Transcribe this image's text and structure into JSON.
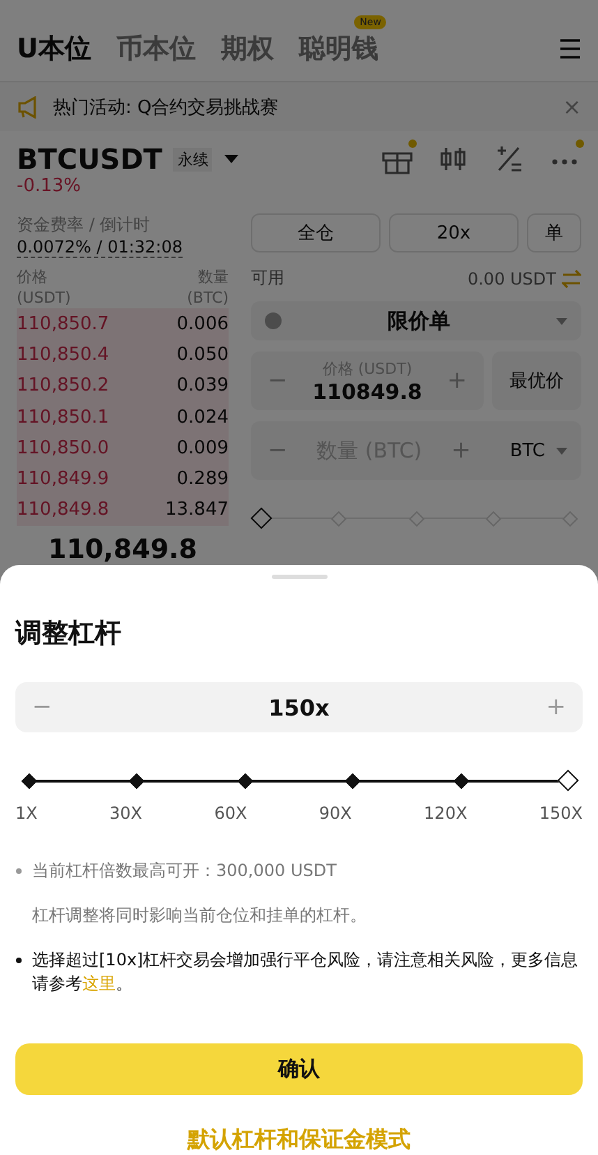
{
  "tabs": [
    {
      "label": "U本位",
      "selected": true
    },
    {
      "label": "币本位",
      "selected": false
    },
    {
      "label": "期权",
      "selected": false
    },
    {
      "label": "聪明钱",
      "selected": false,
      "badge": "New"
    }
  ],
  "announcement": {
    "text": "热门活动: Q合约交易挑战赛",
    "close": "×"
  },
  "symbol": {
    "name": "BTCUSDT",
    "tag": "永续",
    "change": "-0.13%"
  },
  "toolbar": [
    {
      "kind": "gift",
      "dot": true
    },
    {
      "kind": "candles",
      "dot": false
    },
    {
      "kind": "calculator",
      "dot": false
    },
    {
      "kind": "more",
      "dot": true
    }
  ],
  "funding": {
    "label": "资金费率 / 倒计时",
    "value": "0.0072% / 01:32:08"
  },
  "order_book": {
    "columns": [
      {
        "label": "价格",
        "unit": "(USDT)"
      },
      {
        "label": "数量",
        "unit": "(BTC)"
      }
    ],
    "asks": [
      {
        "price": "110,850.7",
        "qty": "0.006"
      },
      {
        "price": "110,850.4",
        "qty": "0.050"
      },
      {
        "price": "110,850.2",
        "qty": "0.039"
      },
      {
        "price": "110,850.1",
        "qty": "0.024"
      },
      {
        "price": "110,850.0",
        "qty": "0.009"
      },
      {
        "price": "110,849.9",
        "qty": "0.289"
      },
      {
        "price": "110,849.8",
        "qty": "13.847"
      }
    ],
    "last_price": "110,849.8"
  },
  "order_form": {
    "margin_mode": "全仓",
    "leverage": "20x",
    "position_mode": "单",
    "available_label": "可用",
    "available": "0.00 USDT",
    "order_type": "限价单",
    "price_label": "价格 (USDT)",
    "price": "110849.8",
    "minus": "−",
    "plus": "+",
    "best_price": "最优价",
    "qty_placeholder": "数量 (BTC)",
    "qty_unit": "BTC",
    "level": 0
  },
  "sheet": {
    "title": "调整杠杆",
    "minus": "−",
    "value": "150x",
    "plus": "+",
    "level": 1,
    "marks": [
      {
        "label": "1X",
        "selected": false
      },
      {
        "label": "30X",
        "selected": false
      },
      {
        "label": "60X",
        "selected": false
      },
      {
        "label": "90X",
        "selected": false
      },
      {
        "label": "120X",
        "selected": false
      },
      {
        "label": "150X",
        "selected": true
      }
    ],
    "notes": [
      {
        "kind": "muted",
        "bullet": true,
        "text": "当前杠杆倍数最高可开：300,000 USDT"
      },
      {
        "kind": "muted",
        "bullet": false,
        "text": "杠杆调整将同时影响当前仓位和挂单的杠杆。"
      },
      {
        "kind": "strong",
        "bullet": true,
        "text": "选择超过[10x]杠杆交易会增加强行平仓风险，请注意相关风险，更多信息请参考",
        "link": "这里",
        "suffix": "。"
      }
    ],
    "confirm": "确认",
    "default_link": "默认杠杆和保证金模式"
  }
}
